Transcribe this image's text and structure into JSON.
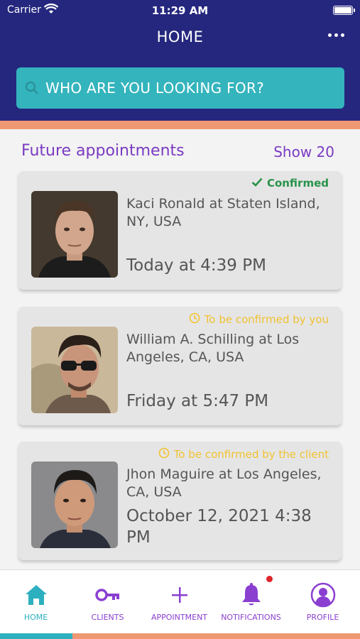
{
  "status_bar": {
    "carrier": "Carrier",
    "time": "11:29 AM"
  },
  "header": {
    "title": "HOME",
    "menu_icon": "more-horizontal-icon"
  },
  "search": {
    "placeholder": "WHO ARE YOU LOOKING FOR?"
  },
  "section": {
    "title": "Future appointments",
    "show_label": "Show 20"
  },
  "appointments": [
    {
      "status": "Confirmed",
      "status_type": "confirmed",
      "name": "Kaci Ronald at Staten Island, NY, USA",
      "when": "Today at 4:39 PM"
    },
    {
      "status": "To be confirmed by you",
      "status_type": "pending",
      "name": "William A. Schilling at Los Angeles, CA, USA",
      "when": "Friday at 5:47 PM"
    },
    {
      "status": "To be confirmed by the client",
      "status_type": "pending",
      "name": "Jhon Maguire at Los Angeles, CA, USA",
      "when": "October 12, 2021 4:38 PM"
    }
  ],
  "tabs": [
    {
      "label": "HOME",
      "icon": "home-icon",
      "active": true
    },
    {
      "label": "CLIENTS",
      "icon": "key-icon"
    },
    {
      "label": "APPOINTMENT",
      "icon": "plus-icon"
    },
    {
      "label": "NOTIFICATIONS",
      "icon": "bell-icon",
      "badge": true
    },
    {
      "label": "PROFILE",
      "icon": "profile-icon"
    }
  ],
  "colors": {
    "header_bg": "#25277e",
    "search_bg": "#34b4bd",
    "accent": "#ee9873",
    "purple": "#7a3bc2",
    "confirmed": "#28934a",
    "pending": "#f2c230",
    "tab_active": "#2cb0bf"
  }
}
